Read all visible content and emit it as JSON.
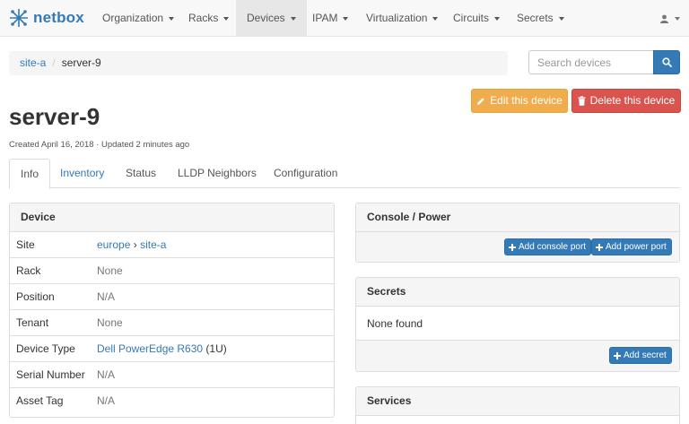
{
  "brand": {
    "name": "netbox"
  },
  "nav": {
    "items": [
      {
        "label": "Organization"
      },
      {
        "label": "Racks"
      },
      {
        "label": "Devices"
      },
      {
        "label": "IPAM"
      },
      {
        "label": "Virtualization"
      },
      {
        "label": "Circuits"
      },
      {
        "label": "Secrets"
      }
    ],
    "user_icon": "user-icon"
  },
  "breadcrumb": {
    "site": "site-a",
    "current": "server-9"
  },
  "search": {
    "placeholder": "Search devices"
  },
  "actions": {
    "edit": "Edit this device",
    "delete": "Delete this device"
  },
  "page": {
    "title": "server-9",
    "created": "Created April 16, 2018 · Updated 2 minutes ago"
  },
  "tabs": [
    "Info",
    "Inventory",
    "Status",
    "LLDP Neighbors",
    "Configuration"
  ],
  "device_panel": {
    "heading": "Device",
    "rows": [
      {
        "key": "Site",
        "region": "europe",
        "sep": "›",
        "site": "site-a"
      },
      {
        "key": "Rack",
        "value": "None"
      },
      {
        "key": "Position",
        "value": "N/A"
      },
      {
        "key": "Tenant",
        "value": "None"
      },
      {
        "key": "Device Type",
        "value_link": "Dell PowerEdge R630",
        "value_extra": "(1U)"
      },
      {
        "key": "Serial Number",
        "value": "N/A"
      },
      {
        "key": "Asset Tag",
        "value": "N/A"
      }
    ]
  },
  "console_panel": {
    "heading": "Console / Power",
    "add_console": "Add console port",
    "add_power": "Add power port"
  },
  "secrets_panel": {
    "heading": "Secrets",
    "empty": "None found",
    "add_secret": "Add secret"
  },
  "services_panel": {
    "heading": "Services"
  },
  "colors": {
    "primary": "#337ab7",
    "warning": "#f0ad4e",
    "danger": "#d9534f"
  }
}
